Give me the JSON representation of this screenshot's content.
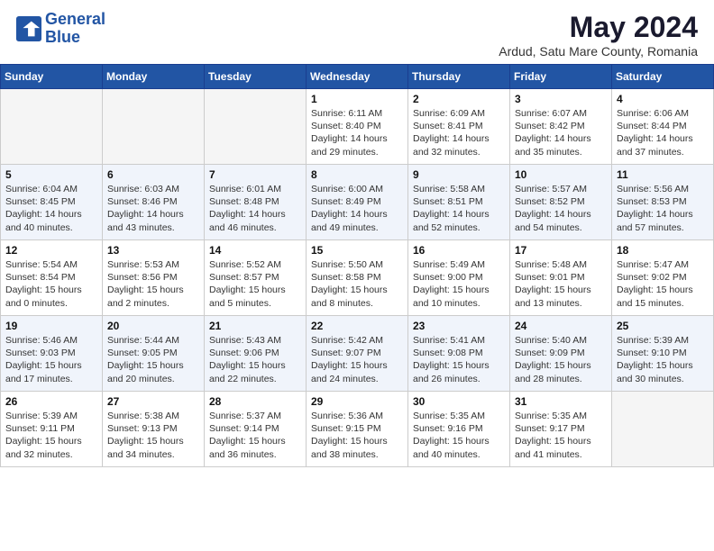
{
  "logo": {
    "line1": "General",
    "line2": "Blue"
  },
  "title": "May 2024",
  "location": "Ardud, Satu Mare County, Romania",
  "weekdays": [
    "Sunday",
    "Monday",
    "Tuesday",
    "Wednesday",
    "Thursday",
    "Friday",
    "Saturday"
  ],
  "weeks": [
    [
      {
        "day": "",
        "info": ""
      },
      {
        "day": "",
        "info": ""
      },
      {
        "day": "",
        "info": ""
      },
      {
        "day": "1",
        "info": "Sunrise: 6:11 AM\nSunset: 8:40 PM\nDaylight: 14 hours\nand 29 minutes."
      },
      {
        "day": "2",
        "info": "Sunrise: 6:09 AM\nSunset: 8:41 PM\nDaylight: 14 hours\nand 32 minutes."
      },
      {
        "day": "3",
        "info": "Sunrise: 6:07 AM\nSunset: 8:42 PM\nDaylight: 14 hours\nand 35 minutes."
      },
      {
        "day": "4",
        "info": "Sunrise: 6:06 AM\nSunset: 8:44 PM\nDaylight: 14 hours\nand 37 minutes."
      }
    ],
    [
      {
        "day": "5",
        "info": "Sunrise: 6:04 AM\nSunset: 8:45 PM\nDaylight: 14 hours\nand 40 minutes."
      },
      {
        "day": "6",
        "info": "Sunrise: 6:03 AM\nSunset: 8:46 PM\nDaylight: 14 hours\nand 43 minutes."
      },
      {
        "day": "7",
        "info": "Sunrise: 6:01 AM\nSunset: 8:48 PM\nDaylight: 14 hours\nand 46 minutes."
      },
      {
        "day": "8",
        "info": "Sunrise: 6:00 AM\nSunset: 8:49 PM\nDaylight: 14 hours\nand 49 minutes."
      },
      {
        "day": "9",
        "info": "Sunrise: 5:58 AM\nSunset: 8:51 PM\nDaylight: 14 hours\nand 52 minutes."
      },
      {
        "day": "10",
        "info": "Sunrise: 5:57 AM\nSunset: 8:52 PM\nDaylight: 14 hours\nand 54 minutes."
      },
      {
        "day": "11",
        "info": "Sunrise: 5:56 AM\nSunset: 8:53 PM\nDaylight: 14 hours\nand 57 minutes."
      }
    ],
    [
      {
        "day": "12",
        "info": "Sunrise: 5:54 AM\nSunset: 8:54 PM\nDaylight: 15 hours\nand 0 minutes."
      },
      {
        "day": "13",
        "info": "Sunrise: 5:53 AM\nSunset: 8:56 PM\nDaylight: 15 hours\nand 2 minutes."
      },
      {
        "day": "14",
        "info": "Sunrise: 5:52 AM\nSunset: 8:57 PM\nDaylight: 15 hours\nand 5 minutes."
      },
      {
        "day": "15",
        "info": "Sunrise: 5:50 AM\nSunset: 8:58 PM\nDaylight: 15 hours\nand 8 minutes."
      },
      {
        "day": "16",
        "info": "Sunrise: 5:49 AM\nSunset: 9:00 PM\nDaylight: 15 hours\nand 10 minutes."
      },
      {
        "day": "17",
        "info": "Sunrise: 5:48 AM\nSunset: 9:01 PM\nDaylight: 15 hours\nand 13 minutes."
      },
      {
        "day": "18",
        "info": "Sunrise: 5:47 AM\nSunset: 9:02 PM\nDaylight: 15 hours\nand 15 minutes."
      }
    ],
    [
      {
        "day": "19",
        "info": "Sunrise: 5:46 AM\nSunset: 9:03 PM\nDaylight: 15 hours\nand 17 minutes."
      },
      {
        "day": "20",
        "info": "Sunrise: 5:44 AM\nSunset: 9:05 PM\nDaylight: 15 hours\nand 20 minutes."
      },
      {
        "day": "21",
        "info": "Sunrise: 5:43 AM\nSunset: 9:06 PM\nDaylight: 15 hours\nand 22 minutes."
      },
      {
        "day": "22",
        "info": "Sunrise: 5:42 AM\nSunset: 9:07 PM\nDaylight: 15 hours\nand 24 minutes."
      },
      {
        "day": "23",
        "info": "Sunrise: 5:41 AM\nSunset: 9:08 PM\nDaylight: 15 hours\nand 26 minutes."
      },
      {
        "day": "24",
        "info": "Sunrise: 5:40 AM\nSunset: 9:09 PM\nDaylight: 15 hours\nand 28 minutes."
      },
      {
        "day": "25",
        "info": "Sunrise: 5:39 AM\nSunset: 9:10 PM\nDaylight: 15 hours\nand 30 minutes."
      }
    ],
    [
      {
        "day": "26",
        "info": "Sunrise: 5:39 AM\nSunset: 9:11 PM\nDaylight: 15 hours\nand 32 minutes."
      },
      {
        "day": "27",
        "info": "Sunrise: 5:38 AM\nSunset: 9:13 PM\nDaylight: 15 hours\nand 34 minutes."
      },
      {
        "day": "28",
        "info": "Sunrise: 5:37 AM\nSunset: 9:14 PM\nDaylight: 15 hours\nand 36 minutes."
      },
      {
        "day": "29",
        "info": "Sunrise: 5:36 AM\nSunset: 9:15 PM\nDaylight: 15 hours\nand 38 minutes."
      },
      {
        "day": "30",
        "info": "Sunrise: 5:35 AM\nSunset: 9:16 PM\nDaylight: 15 hours\nand 40 minutes."
      },
      {
        "day": "31",
        "info": "Sunrise: 5:35 AM\nSunset: 9:17 PM\nDaylight: 15 hours\nand 41 minutes."
      },
      {
        "day": "",
        "info": ""
      }
    ]
  ]
}
